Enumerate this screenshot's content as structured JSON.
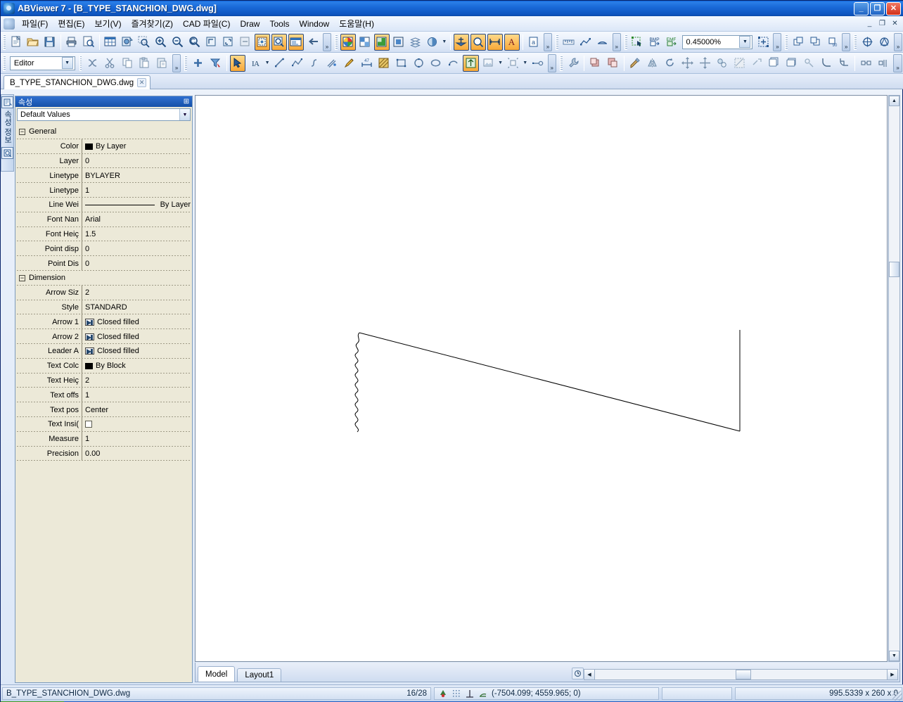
{
  "window": {
    "title": "ABViewer 7 - [B_TYPE_STANCHION_DWG.dwg]",
    "minimize": "_",
    "maximize": "❐",
    "close": "✕",
    "mdi_minimize": "_",
    "mdi_restore": "❐",
    "mdi_close": "✕"
  },
  "menu": {
    "items": [
      {
        "label": "파일(F)"
      },
      {
        "label": "편집(E)"
      },
      {
        "label": "보기(V)"
      },
      {
        "label": "즐겨찾기(Z)"
      },
      {
        "label": "CAD 파일(C)"
      },
      {
        "label": "Draw"
      },
      {
        "label": "Tools"
      },
      {
        "label": "Window"
      },
      {
        "label": "도움말(H)"
      }
    ]
  },
  "toolbar_main": {
    "zoom_value": "0.45000%",
    "groups": [
      {
        "icons": [
          "new-file-icon",
          "open-folder-icon",
          "save-icon"
        ]
      },
      {
        "icons": [
          "print-icon",
          "print-preview-icon"
        ]
      },
      {
        "icons": [
          "table-view-icon",
          "batch-convert-icon",
          "zoom-window-icon",
          "zoom-in-icon",
          "zoom-out-icon",
          "zoom-previous-icon",
          "zoom-all-icon",
          "zoom-extents-icon",
          "zoom-redo-icon",
          "pan-icon"
        ]
      },
      {
        "icons": [
          "measure-area-icon",
          "markup-icon",
          "layers-panel-icon",
          "back-arrow-icon"
        ]
      },
      {
        "icons": [
          "color-palette-icon",
          "background-color-icon",
          "line-color-icon",
          "fill-color-icon",
          "layers-stack-icon",
          "render-icon"
        ]
      },
      {
        "icons": [
          "insert-block-icon",
          "circle-select-icon",
          "dimension-icon",
          "text-icon"
        ]
      },
      {
        "icons": [
          "attributes-icon"
        ]
      },
      {
        "icons": [
          "measure-length-icon",
          "measure-polyline-icon",
          "measure-angle-icon"
        ]
      },
      {
        "icons": [
          "select-objects-icon",
          "export-bmp-icon",
          "export-emf-icon"
        ]
      },
      {
        "icons": [
          "fit-view-icon"
        ]
      },
      {
        "icons": [
          "copy-view-icon",
          "paste-view-icon",
          "rotate-90-icon"
        ]
      },
      {
        "icons": [
          "snap-center-icon",
          "snap-node-icon"
        ]
      }
    ]
  },
  "toolbar_edit": {
    "mode_value": "Editor",
    "groups": [
      {
        "icons": [
          "undo-redo-icon",
          "cut-icon",
          "copy-icon",
          "paste-icon",
          "paste-special-icon"
        ]
      },
      {
        "icons": [
          "add-icon",
          "filter-icon"
        ]
      },
      {
        "icons": [
          "select-arrow-icon",
          "text-tool-icon",
          "line-icon",
          "polyline-icon",
          "spline-icon",
          "multiline-icon",
          "marker-icon",
          "dimension-tool-icon",
          "hatch-icon",
          "rectangle-icon",
          "circle-icon",
          "ellipse-icon",
          "arc-icon",
          "block-insert-icon"
        ]
      },
      {
        "icons": [
          "image-insert-icon",
          "explode-icon",
          "measure-tool-icon"
        ]
      },
      {
        "icons": [
          "wrench-icon"
        ]
      },
      {
        "icons": [
          "bring-front-icon",
          "send-back-icon"
        ]
      },
      {
        "icons": [
          "eyedropper-icon",
          "mirror-icon",
          "rotate-icon",
          "move-icon",
          "scale-icon"
        ]
      },
      {
        "icons": [
          "array-icon",
          "erase-icon",
          "trim-icon",
          "extend-icon",
          "offset-icon",
          "break-icon",
          "fillet-icon",
          "chamfer-icon"
        ]
      },
      {
        "icons": [
          "align-left-icon",
          "align-right-icon"
        ]
      }
    ]
  },
  "document_tab": {
    "label": "B_TYPE_STANCHION_DWG.dwg",
    "close": "✕"
  },
  "vdock": {
    "top_icon": "properties-icon",
    "label": "속성 정보",
    "bottom_icon": "preview-icon"
  },
  "properties_panel": {
    "title": "속성",
    "pin": "⊞",
    "selector_value": "Default Values",
    "selector_arrow": "▼",
    "rows": [
      {
        "kind": "group",
        "name": "General",
        "value": "",
        "icon": ""
      },
      {
        "kind": "prop",
        "name": "Color",
        "value": "By Layer",
        "icon": "color-swatch"
      },
      {
        "kind": "prop",
        "name": "Layer",
        "value": "0",
        "icon": ""
      },
      {
        "kind": "prop",
        "name": "Linetype",
        "value": "BYLAYER",
        "icon": ""
      },
      {
        "kind": "prop",
        "name": "Linetype",
        "value": "1",
        "icon": ""
      },
      {
        "kind": "prop",
        "name": "Line Wei",
        "value": "By Layer",
        "icon": "lineweight"
      },
      {
        "kind": "prop",
        "name": "Font Nan",
        "value": "Arial",
        "icon": ""
      },
      {
        "kind": "prop",
        "name": "Font Heiç",
        "value": "1.5",
        "icon": ""
      },
      {
        "kind": "prop",
        "name": "Point disp",
        "value": "0",
        "icon": ""
      },
      {
        "kind": "prop",
        "name": "Point Dis",
        "value": "0",
        "icon": ""
      },
      {
        "kind": "group",
        "name": "Dimension",
        "value": "",
        "icon": ""
      },
      {
        "kind": "prop",
        "name": "Arrow Siz",
        "value": "2",
        "icon": ""
      },
      {
        "kind": "prop",
        "name": "Style",
        "value": "STANDARD",
        "icon": ""
      },
      {
        "kind": "prop",
        "name": "Arrow 1",
        "value": "Closed filled",
        "icon": "arrow-glyph"
      },
      {
        "kind": "prop",
        "name": "Arrow 2",
        "value": "Closed filled",
        "icon": "arrow-glyph"
      },
      {
        "kind": "prop",
        "name": "Leader A",
        "value": "Closed filled",
        "icon": "arrow-glyph"
      },
      {
        "kind": "prop",
        "name": "Text Colc",
        "value": "By Block",
        "icon": "color-swatch"
      },
      {
        "kind": "prop",
        "name": "Text Heiç",
        "value": "2",
        "icon": ""
      },
      {
        "kind": "prop",
        "name": "Text offs",
        "value": "1",
        "icon": ""
      },
      {
        "kind": "prop",
        "name": "Text pos",
        "value": "Center",
        "icon": ""
      },
      {
        "kind": "prop",
        "name": "Text Insi(",
        "value": "",
        "icon": "checkbox"
      },
      {
        "kind": "prop",
        "name": "Measure",
        "value": "1",
        "icon": ""
      },
      {
        "kind": "prop",
        "name": "Precision",
        "value": "0.00",
        "icon": ""
      }
    ]
  },
  "layout_tabs": {
    "tabs": [
      {
        "label": "Model",
        "selected": true
      },
      {
        "label": "Layout1",
        "selected": false
      }
    ],
    "extra_icon": "refresh-layouts-icon",
    "scroll_left": "◀",
    "scroll_right": "▶"
  },
  "scrollbars": {
    "up": "▲",
    "down": "▼",
    "left": "◀",
    "right": "▶"
  },
  "statusbar": {
    "filename": "B_TYPE_STANCHION_DWG.dwg",
    "page_counter": "16/28",
    "coordinates": "(-7504.099;  4559.965;  0)",
    "size": "995.5339 x 260 x 0",
    "icons": [
      "osnap-icon",
      "grid-icon",
      "ortho-icon",
      "polar-icon"
    ]
  },
  "drawing": {
    "description": "wedge outline with break-line on left edge",
    "stroke_color": "#000000",
    "background": "#ffffff"
  }
}
